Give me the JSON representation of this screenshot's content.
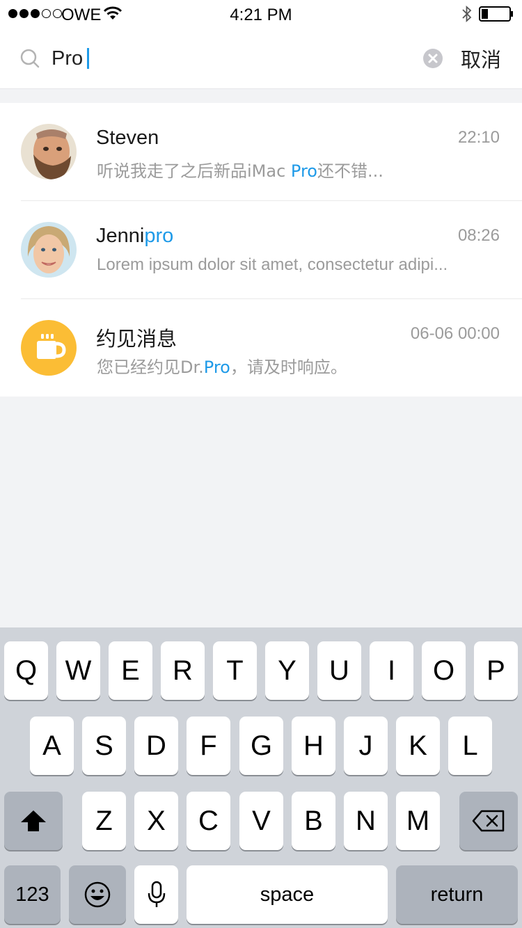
{
  "status_bar": {
    "carrier": "OWE",
    "time": "4:21 PM",
    "signal_bars": 3
  },
  "search": {
    "query": "Pro",
    "cancel_label": "取消"
  },
  "results": [
    {
      "name_plain": "Steven",
      "name_highlight": "",
      "time": "22:10",
      "message_before": "听说我走了之后新品iMac ",
      "message_highlight": "Pro",
      "message_after": "还不错...",
      "avatar": "man-bearded-photo"
    },
    {
      "name_plain": "Jenni",
      "name_highlight": "pro",
      "time": "08:26",
      "message_before": "Lorem ipsum dolor sit amet, consectetur adipi...",
      "message_highlight": "",
      "message_after": "",
      "avatar": "woman-smiling-photo"
    },
    {
      "name_plain": "约见消息",
      "name_highlight": "",
      "time": "06-06 00:00",
      "message_before": "您已经约见Dr.",
      "message_highlight": "Pro",
      "message_after": "，请及时响应。",
      "avatar": "coffee-cup-icon",
      "avatar_color": "#fbbd35"
    }
  ],
  "keyboard": {
    "row1": [
      "Q",
      "W",
      "E",
      "R",
      "T",
      "Y",
      "U",
      "I",
      "O",
      "P"
    ],
    "row2": [
      "A",
      "S",
      "D",
      "F",
      "G",
      "H",
      "J",
      "K",
      "L"
    ],
    "row3": [
      "Z",
      "X",
      "C",
      "V",
      "B",
      "N",
      "M"
    ],
    "numbers_label": "123",
    "space_label": "space",
    "return_label": "return"
  },
  "colors": {
    "highlight": "#1e9ae8",
    "keyboard_bg": "#cfd3d9",
    "special_key": "#adb3bc"
  }
}
